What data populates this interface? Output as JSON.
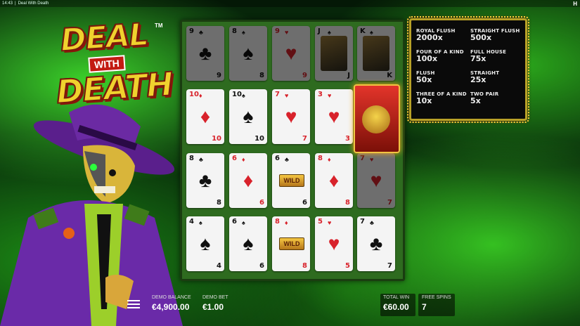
{
  "statusbar": {
    "time": "14:43",
    "title": "Deal With Death",
    "brand": "H"
  },
  "logo": {
    "line1": "DEAL",
    "line2": "WITH",
    "line3": "DEATH",
    "tm": "TM"
  },
  "paytable": [
    {
      "name": "ROYAL FLUSH",
      "value": "2000x"
    },
    {
      "name": "STRAIGHT FLUSH",
      "value": "500x"
    },
    {
      "name": "FOUR OF A KIND",
      "value": "100x"
    },
    {
      "name": "FULL HOUSE",
      "value": "75x"
    },
    {
      "name": "FLUSH",
      "value": "50x"
    },
    {
      "name": "STRAIGHT",
      "value": "25x"
    },
    {
      "name": "THREE OF A KIND",
      "value": "10x"
    },
    {
      "name": "TWO PAIR",
      "value": "5x"
    }
  ],
  "cards": {
    "row1": [
      {
        "rank": "9",
        "suit": "♣",
        "color": "blk",
        "dim": true
      },
      {
        "rank": "8",
        "suit": "♠",
        "color": "blk",
        "dim": true
      },
      {
        "rank": "9",
        "suit": "♥",
        "color": "red",
        "dim": true
      },
      {
        "rank": "J",
        "suit": "♠",
        "color": "blk",
        "dim": true
      },
      {
        "rank": "K",
        "suit": "♠",
        "color": "blk",
        "dim": true
      }
    ],
    "row2": [
      {
        "rank": "10",
        "suit": "♦",
        "color": "red"
      },
      {
        "rank": "10",
        "suit": "♠",
        "color": "blk"
      },
      {
        "rank": "7",
        "suit": "♥",
        "color": "red"
      },
      {
        "rank": "3",
        "suit": "♥",
        "color": "red"
      }
    ],
    "row3": [
      {
        "rank": "8",
        "suit": "♣",
        "color": "blk"
      },
      {
        "rank": "6",
        "suit": "♦",
        "color": "red"
      },
      {
        "rank": "6",
        "suit": "♣",
        "color": "blk",
        "wild": "WILD"
      },
      {
        "rank": "8",
        "suit": "♦",
        "color": "red"
      },
      {
        "rank": "7",
        "suit": "♥",
        "color": "red",
        "dim": true
      }
    ],
    "row4": [
      {
        "rank": "4",
        "suit": "♠",
        "color": "blk"
      },
      {
        "rank": "6",
        "suit": "♠",
        "color": "blk"
      },
      {
        "rank": "8",
        "suit": "♦",
        "color": "red",
        "wild": "WILD"
      },
      {
        "rank": "5",
        "suit": "♥",
        "color": "red"
      },
      {
        "rank": "7",
        "suit": "♣",
        "color": "blk"
      }
    ]
  },
  "footer": {
    "balance_label": "DEMO BALANCE",
    "balance": "€4,900.00",
    "bet_label": "DEMO BET",
    "bet": "€1.00",
    "totalwin_label": "TOTAL WIN",
    "totalwin": "€60.00",
    "freespins_label": "FREE SPINS",
    "freespins": "7"
  },
  "colors": {
    "accent": "#f0d22e",
    "felt": "#2e6b1f",
    "heart": "#d8222b"
  }
}
